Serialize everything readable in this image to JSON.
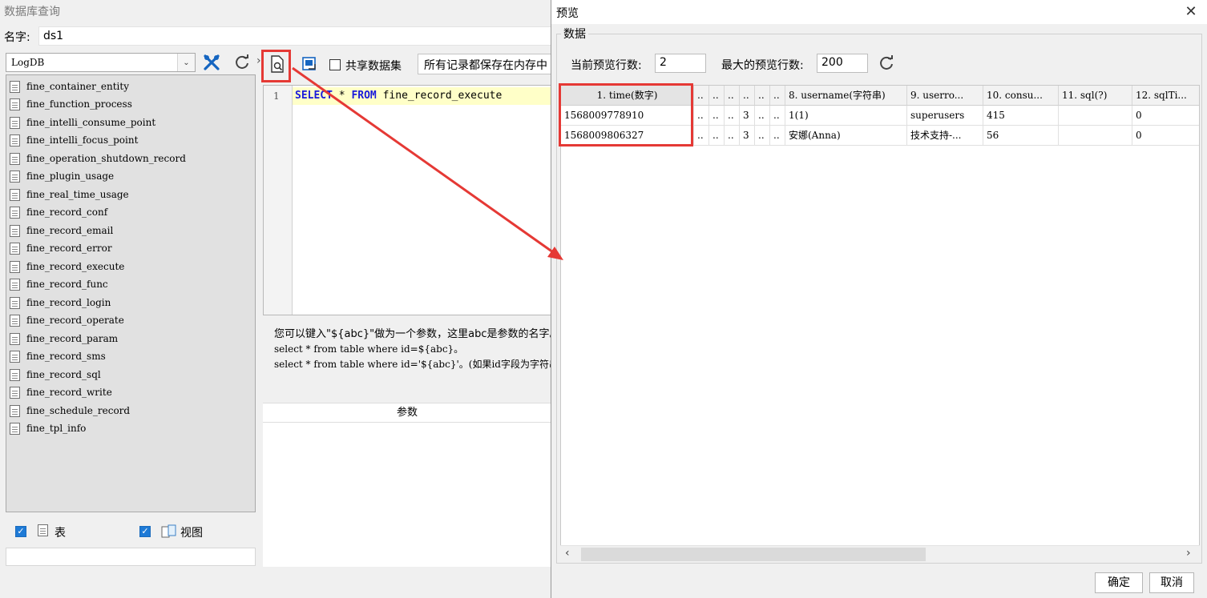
{
  "main": {
    "title": "数据库查询",
    "name_label": "名字:",
    "name_value": "ds1",
    "database": "LogDB",
    "share_label": "共享数据集",
    "memory_label": "所有记录都保存在内存中",
    "tables": [
      "fine_container_entity",
      "fine_function_process",
      "fine_intelli_consume_point",
      "fine_intelli_focus_point",
      "fine_operation_shutdown_record",
      "fine_plugin_usage",
      "fine_real_time_usage",
      "fine_record_conf",
      "fine_record_email",
      "fine_record_error",
      "fine_record_execute",
      "fine_record_func",
      "fine_record_login",
      "fine_record_operate",
      "fine_record_param",
      "fine_record_sms",
      "fine_record_sql",
      "fine_record_write",
      "fine_schedule_record",
      "fine_tpl_info"
    ],
    "table_check_label": "表",
    "view_check_label": "视图",
    "editor": {
      "line_number": "1",
      "kw_select": "SELECT",
      "star": " * ",
      "kw_from": "FROM",
      "table": " fine_record_execute"
    },
    "hint_lines": [
      "您可以键入\"${abc}\"做为一个参数，这里abc是参数的名字。例如：",
      "select * from table where id=${abc}。",
      "select * from table where id='${abc}'。(如果id字段为字符串)"
    ],
    "param_tab": "参数"
  },
  "dialog": {
    "title": "预览",
    "group_label": "数据",
    "current_rows_label": "当前预览行数:",
    "current_rows_value": "2",
    "max_rows_label": "最大的预览行数:",
    "max_rows_value": "200",
    "columns": [
      "1. time(数字)",
      "..",
      "..",
      "..",
      "..",
      "..",
      "..",
      "8. username(字符串)",
      "9. userro...",
      "10. consu...",
      "11. sql(?)",
      "12. sqlTi..."
    ],
    "rows": [
      [
        "1568009778910",
        "..",
        "..",
        "..",
        "3",
        "..",
        "..",
        "1(1)",
        "superusers",
        "415",
        "",
        "0"
      ],
      [
        "1568009806327",
        "..",
        "..",
        "..",
        "3",
        "..",
        "..",
        "安娜(Anna)",
        "技术支持-...",
        "56",
        "",
        "0"
      ]
    ],
    "ok_label": "确定",
    "cancel_label": "取消"
  },
  "colors": {
    "annotation": "#e53935",
    "accent": "#1e7ad6",
    "keyword": "#1a1adb"
  }
}
